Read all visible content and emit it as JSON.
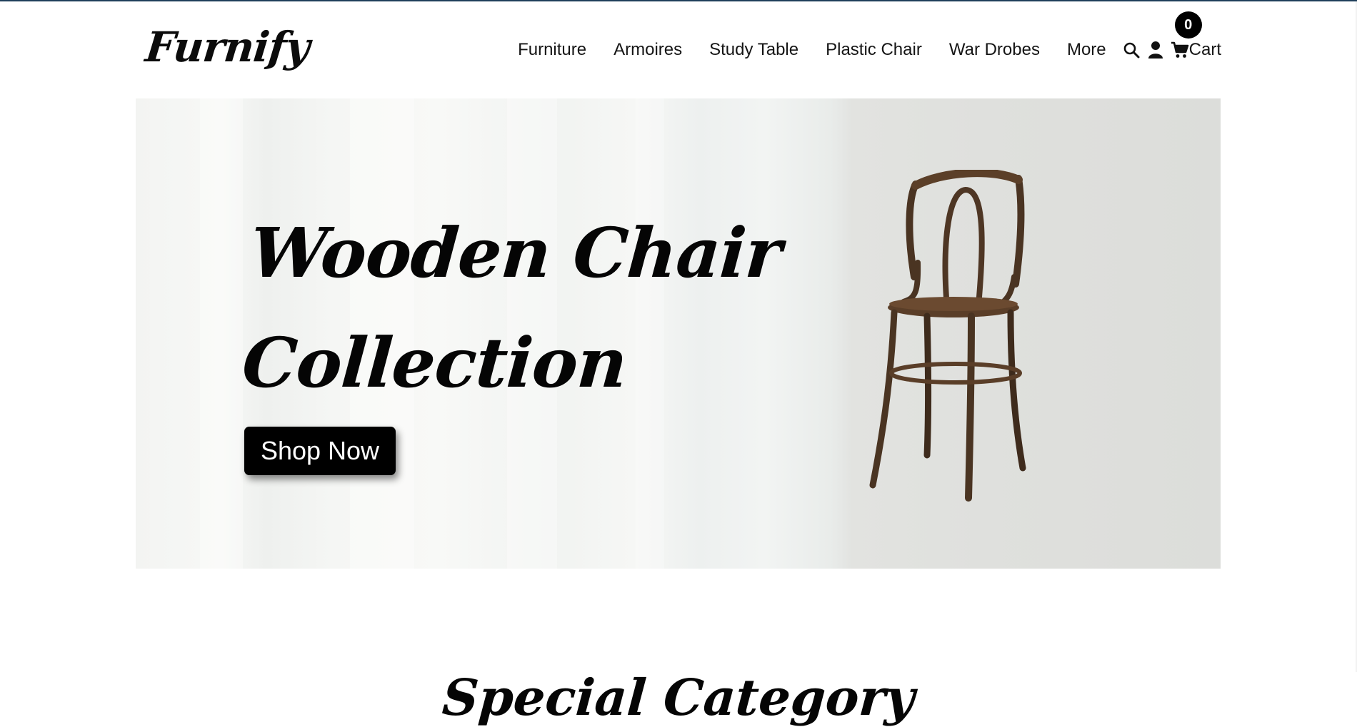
{
  "brand": {
    "logo_text": "Furnify"
  },
  "nav": {
    "items": [
      {
        "label": "Furniture"
      },
      {
        "label": "Armoires"
      },
      {
        "label": "Study Table"
      },
      {
        "label": "Plastic Chair"
      },
      {
        "label": "War Drobes"
      },
      {
        "label": "More"
      }
    ],
    "search_icon": "search-icon",
    "user_icon": "user-icon",
    "cart": {
      "icon": "cart-icon",
      "label": "Cart",
      "count": "0"
    }
  },
  "hero": {
    "title_line1": "Wooden Chair",
    "title_line2": "Collection",
    "cta_label": "Shop Now",
    "image": "wooden-chair-image"
  },
  "sections": {
    "special_category_title": "Special Category"
  },
  "colors": {
    "accent": "#000000",
    "text": "#111111",
    "top_border": "#1f3f5a"
  }
}
